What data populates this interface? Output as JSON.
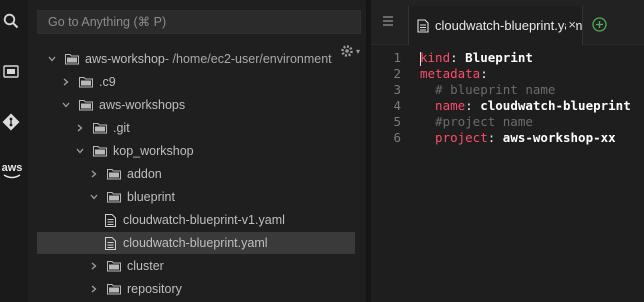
{
  "search": {
    "placeholder": "Go to Anything (⌘ P)"
  },
  "activity": {
    "icons": [
      "search-icon",
      "files-icon",
      "git-icon",
      "aws-icon"
    ],
    "aws_label": "aws"
  },
  "tree": {
    "rows": [
      {
        "name": "aws-workshop",
        "suffix": " - /home/ec2-user/environment",
        "type": "folder",
        "expanded": true,
        "depth": 0
      },
      {
        "name": ".c9",
        "type": "folder",
        "expanded": false,
        "depth": 1
      },
      {
        "name": "aws-workshops",
        "type": "folder",
        "expanded": true,
        "depth": 1
      },
      {
        "name": ".git",
        "type": "folder",
        "expanded": false,
        "depth": 2
      },
      {
        "name": "kop_workshop",
        "type": "folder",
        "expanded": true,
        "depth": 2
      },
      {
        "name": "addon",
        "type": "folder",
        "expanded": false,
        "depth": 3
      },
      {
        "name": "blueprint",
        "type": "folder",
        "expanded": true,
        "depth": 3
      },
      {
        "name": "cloudwatch-blueprint-v1.yaml",
        "type": "file",
        "depth": 4
      },
      {
        "name": "cloudwatch-blueprint.yaml",
        "type": "file",
        "depth": 4,
        "selected": true
      },
      {
        "name": "cluster",
        "type": "folder",
        "expanded": false,
        "depth": 3
      },
      {
        "name": "repository",
        "type": "folder",
        "expanded": false,
        "depth": 3
      }
    ]
  },
  "editor": {
    "tab_label": "cloudwatch-blueprint.yaml",
    "tab_close": "×",
    "lines": [
      {
        "n": "1",
        "key": "kind",
        "colon": ": ",
        "value": "Blueprint",
        "comment": ""
      },
      {
        "n": "2",
        "key": "metadata",
        "colon": ":",
        "value": "",
        "comment": ""
      },
      {
        "n": "3",
        "key": "",
        "colon": "",
        "value": "",
        "comment": "  # blueprint name"
      },
      {
        "n": "4",
        "key": "  name",
        "colon": ": ",
        "value": "cloudwatch-blueprint",
        "comment": ""
      },
      {
        "n": "5",
        "key": "",
        "colon": "",
        "value": "",
        "comment": "  #project name"
      },
      {
        "n": "6",
        "key": "  project",
        "colon": ": ",
        "value": "aws-workshop-xx",
        "comment": ""
      }
    ]
  },
  "colors": {
    "yaml_key": "#ff4a6b",
    "yaml_comment": "#6b6b6b",
    "add_tab": "#4caf50",
    "selected_row": "#3a3a3a"
  }
}
